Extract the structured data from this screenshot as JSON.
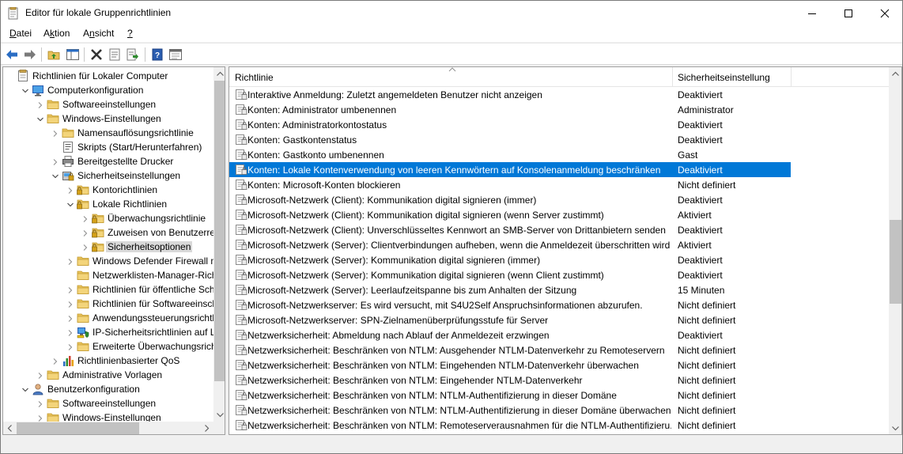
{
  "window": {
    "title": "Editor für lokale Gruppenrichtlinien"
  },
  "menu": [
    {
      "label": "Datei",
      "underline": "D",
      "rest": "atei"
    },
    {
      "label": "Aktion",
      "underline": "k",
      "pre": "A",
      "rest": "tion"
    },
    {
      "label": "Ansicht",
      "underline": "n",
      "pre": "A",
      "rest": "sicht"
    },
    {
      "label": "?",
      "underline": "?"
    }
  ],
  "tree": [
    {
      "label": "Richtlinien für Lokaler Computer",
      "level": 0,
      "exp": "none",
      "icon": "document-icon"
    },
    {
      "label": "Computerkonfiguration",
      "level": 1,
      "exp": "open",
      "icon": "computer-icon"
    },
    {
      "label": "Softwareeinstellungen",
      "level": 2,
      "exp": "closed",
      "icon": "folder-icon"
    },
    {
      "label": "Windows-Einstellungen",
      "level": 2,
      "exp": "open",
      "icon": "folder-icon"
    },
    {
      "label": "Namensauflösungsrichtlinie",
      "level": 3,
      "exp": "closed",
      "icon": "folder-icon"
    },
    {
      "label": "Skripts (Start/Herunterfahren)",
      "level": 3,
      "exp": "none",
      "icon": "script-icon"
    },
    {
      "label": "Bereitgestellte Drucker",
      "level": 3,
      "exp": "closed",
      "icon": "printer-icon"
    },
    {
      "label": "Sicherheitseinstellungen",
      "level": 3,
      "exp": "open",
      "icon": "security-settings-icon"
    },
    {
      "label": "Kontorichtlinien",
      "level": 4,
      "exp": "closed",
      "icon": "locked-folder-icon"
    },
    {
      "label": "Lokale Richtlinien",
      "level": 4,
      "exp": "open",
      "icon": "locked-folder-icon"
    },
    {
      "label": "Überwachungsrichtlinie",
      "level": 5,
      "exp": "closed",
      "icon": "locked-folder-icon"
    },
    {
      "label": "Zuweisen von Benutzerrech",
      "level": 5,
      "exp": "closed",
      "icon": "locked-folder-icon"
    },
    {
      "label": "Sicherheitsoptionen",
      "level": 5,
      "exp": "closed",
      "icon": "locked-folder-icon",
      "selected": true
    },
    {
      "label": "Windows Defender Firewall mit",
      "level": 4,
      "exp": "closed",
      "icon": "folder-icon"
    },
    {
      "label": "Netzwerklisten-Manager-Richtl",
      "level": 4,
      "exp": "none",
      "icon": "folder-icon"
    },
    {
      "label": "Richtlinien für öffentliche Schlü",
      "level": 4,
      "exp": "closed",
      "icon": "folder-icon"
    },
    {
      "label": "Richtlinien für Softwareeinschrä",
      "level": 4,
      "exp": "closed",
      "icon": "folder-icon"
    },
    {
      "label": "Anwendungssteuerungsrichtlir",
      "level": 4,
      "exp": "closed",
      "icon": "folder-icon"
    },
    {
      "label": "IP-Sicherheitsrichtlinien auf Lol",
      "level": 4,
      "exp": "closed",
      "icon": "ip-security-icon"
    },
    {
      "label": "Erweiterte Überwachungsrichtli",
      "level": 4,
      "exp": "closed",
      "icon": "folder-icon"
    },
    {
      "label": "Richtlinienbasierter QoS",
      "level": 3,
      "exp": "closed",
      "icon": "qos-chart-icon"
    },
    {
      "label": "Administrative Vorlagen",
      "level": 2,
      "exp": "closed",
      "icon": "folder-icon"
    },
    {
      "label": "Benutzerkonfiguration",
      "level": 1,
      "exp": "open",
      "icon": "user-icon"
    },
    {
      "label": "Softwareeinstellungen",
      "level": 2,
      "exp": "closed",
      "icon": "folder-icon"
    },
    {
      "label": "Windows-Einstellungen",
      "level": 2,
      "exp": "closed",
      "icon": "folder-icon"
    }
  ],
  "list": {
    "columns": [
      "Richtlinie",
      "Sicherheitseinstellung"
    ],
    "rows": [
      {
        "policy": "Interaktive Anmeldung: Zuletzt angemeldeten Benutzer nicht anzeigen",
        "value": "Deaktiviert"
      },
      {
        "policy": "Konten: Administrator umbenennen",
        "value": "Administrator"
      },
      {
        "policy": "Konten: Administratorkontostatus",
        "value": "Deaktiviert"
      },
      {
        "policy": "Konten: Gastkontenstatus",
        "value": "Deaktiviert"
      },
      {
        "policy": "Konten: Gastkonto umbenennen",
        "value": "Gast"
      },
      {
        "policy": "Konten: Lokale Kontenverwendung von leeren Kennwörtern auf Konsolenanmeldung beschränken",
        "value": "Deaktiviert",
        "selected": true
      },
      {
        "policy": "Konten: Microsoft-Konten blockieren",
        "value": "Nicht definiert"
      },
      {
        "policy": "Microsoft-Netzwerk (Client): Kommunikation digital signieren (immer)",
        "value": "Deaktiviert"
      },
      {
        "policy": "Microsoft-Netzwerk (Client): Kommunikation digital signieren (wenn Server zustimmt)",
        "value": "Aktiviert"
      },
      {
        "policy": "Microsoft-Netzwerk (Client): Unverschlüsseltes Kennwort an SMB-Server von Drittanbietern senden",
        "value": "Deaktiviert"
      },
      {
        "policy": "Microsoft-Netzwerk (Server): Clientverbindungen aufheben, wenn die Anmeldezeit überschritten wird",
        "value": "Aktiviert"
      },
      {
        "policy": "Microsoft-Netzwerk (Server): Kommunikation digital signieren (immer)",
        "value": "Deaktiviert"
      },
      {
        "policy": "Microsoft-Netzwerk (Server): Kommunikation digital signieren (wenn Client zustimmt)",
        "value": "Deaktiviert"
      },
      {
        "policy": "Microsoft-Netzwerk (Server): Leerlaufzeitspanne bis zum Anhalten der Sitzung",
        "value": "15 Minuten"
      },
      {
        "policy": "Microsoft-Netzwerkserver: Es wird versucht, mit S4U2Self Anspruchsinformationen abzurufen.",
        "value": "Nicht definiert"
      },
      {
        "policy": "Microsoft-Netzwerkserver: SPN-Zielnamenüberprüfungsstufe für Server",
        "value": "Nicht definiert"
      },
      {
        "policy": "Netzwerksicherheit: Abmeldung nach Ablauf der Anmeldezeit erzwingen",
        "value": "Deaktiviert"
      },
      {
        "policy": "Netzwerksicherheit: Beschränken von NTLM: Ausgehender NTLM-Datenverkehr zu Remoteservern",
        "value": "Nicht definiert"
      },
      {
        "policy": "Netzwerksicherheit: Beschränken von NTLM: Eingehenden NTLM-Datenverkehr überwachen",
        "value": "Nicht definiert"
      },
      {
        "policy": "Netzwerksicherheit: Beschränken von NTLM: Eingehender NTLM-Datenverkehr",
        "value": "Nicht definiert"
      },
      {
        "policy": "Netzwerksicherheit: Beschränken von NTLM: NTLM-Authentifizierung in dieser Domäne",
        "value": "Nicht definiert"
      },
      {
        "policy": "Netzwerksicherheit: Beschränken von NTLM: NTLM-Authentifizierung in dieser Domäne überwachen",
        "value": "Nicht definiert"
      },
      {
        "policy": "Netzwerksicherheit: Beschränken von NTLM: Remoteserverausnahmen für die NTLM-Authentifizieru...",
        "value": "Nicht definiert"
      }
    ]
  },
  "colors": {
    "selection": "#0078d7",
    "tree_selection": "#d9d9d9",
    "folder": "#e8c25a",
    "toolbar_blue": "#2a6dc4"
  }
}
